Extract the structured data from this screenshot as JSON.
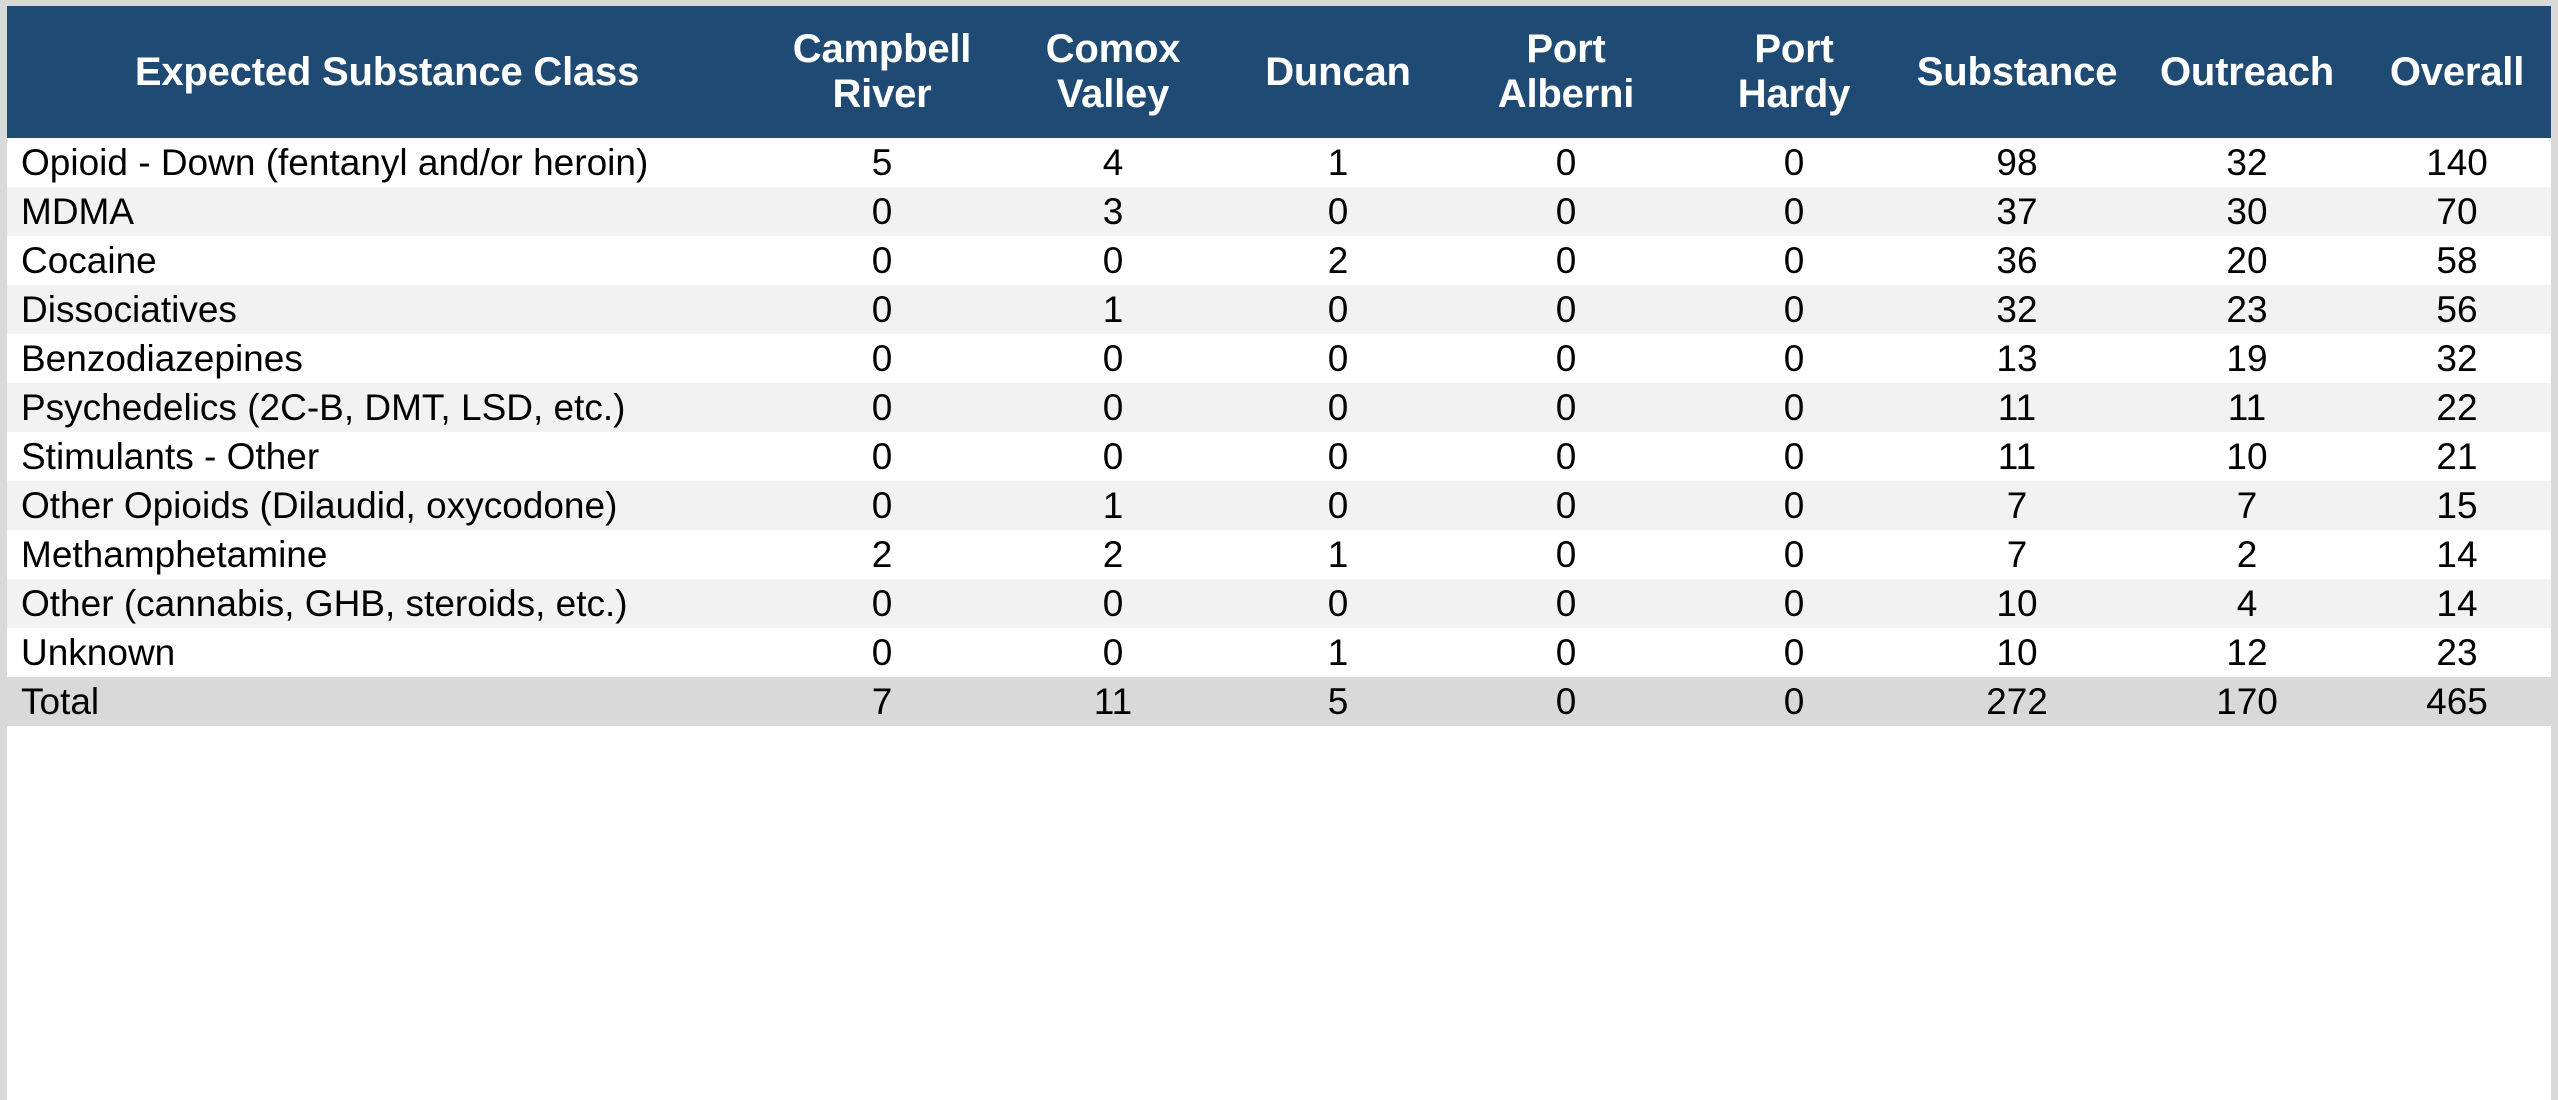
{
  "table": {
    "columns": [
      {
        "key": "label",
        "label": "Expected Substance Class",
        "align": "left"
      },
      {
        "key": "campbell",
        "label": "Campbell River",
        "align": "center"
      },
      {
        "key": "comox",
        "label": "Comox Valley",
        "align": "center"
      },
      {
        "key": "duncan",
        "label": "Duncan",
        "align": "center"
      },
      {
        "key": "alberni",
        "label": "Port Alberni",
        "align": "center"
      },
      {
        "key": "hardy",
        "label": "Port Hardy",
        "align": "center"
      },
      {
        "key": "substance",
        "label": "Substance",
        "align": "center"
      },
      {
        "key": "outreach",
        "label": "Outreach",
        "align": "center"
      },
      {
        "key": "overall",
        "label": "Overall",
        "align": "center"
      }
    ],
    "header": {
      "col_0": "Expected Substance Class",
      "col_1": "Campbell River",
      "col_2": "Comox Valley",
      "col_3": "Duncan",
      "col_4": "Port Alberni",
      "col_5": "Port Hardy",
      "col_6": "Substance",
      "col_7": "Outreach",
      "col_8": "Overall"
    },
    "rows": [
      {
        "label": "Opioid - Down (fentanyl and/or heroin)",
        "campbell": "5",
        "comox": "4",
        "duncan": "1",
        "alberni": "0",
        "hardy": "0",
        "substance": "98",
        "outreach": "32",
        "overall": "140"
      },
      {
        "label": "MDMA",
        "campbell": "0",
        "comox": "3",
        "duncan": "0",
        "alberni": "0",
        "hardy": "0",
        "substance": "37",
        "outreach": "30",
        "overall": "70"
      },
      {
        "label": "Cocaine",
        "campbell": "0",
        "comox": "0",
        "duncan": "2",
        "alberni": "0",
        "hardy": "0",
        "substance": "36",
        "outreach": "20",
        "overall": "58"
      },
      {
        "label": "Dissociatives",
        "campbell": "0",
        "comox": "1",
        "duncan": "0",
        "alberni": "0",
        "hardy": "0",
        "substance": "32",
        "outreach": "23",
        "overall": "56"
      },
      {
        "label": "Benzodiazepines",
        "campbell": "0",
        "comox": "0",
        "duncan": "0",
        "alberni": "0",
        "hardy": "0",
        "substance": "13",
        "outreach": "19",
        "overall": "32"
      },
      {
        "label": "Psychedelics (2C-B, DMT, LSD, etc.)",
        "campbell": "0",
        "comox": "0",
        "duncan": "0",
        "alberni": "0",
        "hardy": "0",
        "substance": "11",
        "outreach": "11",
        "overall": "22"
      },
      {
        "label": "Stimulants - Other",
        "campbell": "0",
        "comox": "0",
        "duncan": "0",
        "alberni": "0",
        "hardy": "0",
        "substance": "11",
        "outreach": "10",
        "overall": "21"
      },
      {
        "label": "Other Opioids (Dilaudid, oxycodone)",
        "campbell": "0",
        "comox": "1",
        "duncan": "0",
        "alberni": "0",
        "hardy": "0",
        "substance": "7",
        "outreach": "7",
        "overall": "15"
      },
      {
        "label": "Methamphetamine",
        "campbell": "2",
        "comox": "2",
        "duncan": "1",
        "alberni": "0",
        "hardy": "0",
        "substance": "7",
        "outreach": "2",
        "overall": "14"
      },
      {
        "label": "Other (cannabis, GHB, steroids, etc.)",
        "campbell": "0",
        "comox": "0",
        "duncan": "0",
        "alberni": "0",
        "hardy": "0",
        "substance": "10",
        "outreach": "4",
        "overall": "14"
      },
      {
        "label": "Unknown",
        "campbell": "0",
        "comox": "0",
        "duncan": "1",
        "alberni": "0",
        "hardy": "0",
        "substance": "10",
        "outreach": "12",
        "overall": "23"
      }
    ],
    "total_row": {
      "label": "Total",
      "campbell": "7",
      "comox": "11",
      "duncan": "5",
      "alberni": "0",
      "hardy": "0",
      "substance": "272",
      "outreach": "170",
      "overall": "465"
    }
  },
  "colors": {
    "header_background": "#1F4A73",
    "header_text": "#FFFFFF",
    "row_odd": "#FFFFFF",
    "row_even": "#F2F2F2",
    "total_row": "#D9D9D9",
    "frame": "#D9D9D9",
    "body_text": "#000000"
  },
  "chart_data": {
    "type": "table",
    "title": "Expected Substance Class",
    "categories": [
      "Opioid - Down (fentanyl and/or heroin)",
      "MDMA",
      "Cocaine",
      "Dissociatives",
      "Benzodiazepines",
      "Psychedelics (2C-B, DMT, LSD, etc.)",
      "Stimulants - Other",
      "Other Opioids (Dilaudid, oxycodone)",
      "Methamphetamine",
      "Other (cannabis, GHB, steroids, etc.)",
      "Unknown",
      "Total"
    ],
    "series": [
      {
        "name": "Campbell River",
        "values": [
          5,
          0,
          0,
          0,
          0,
          0,
          0,
          0,
          2,
          0,
          0,
          7
        ]
      },
      {
        "name": "Comox Valley",
        "values": [
          4,
          3,
          0,
          1,
          0,
          0,
          0,
          1,
          2,
          0,
          0,
          11
        ]
      },
      {
        "name": "Duncan",
        "values": [
          1,
          0,
          2,
          0,
          0,
          0,
          0,
          0,
          1,
          0,
          1,
          5
        ]
      },
      {
        "name": "Port Alberni",
        "values": [
          0,
          0,
          0,
          0,
          0,
          0,
          0,
          0,
          0,
          0,
          0,
          0
        ]
      },
      {
        "name": "Port Hardy",
        "values": [
          0,
          0,
          0,
          0,
          0,
          0,
          0,
          0,
          0,
          0,
          0,
          0
        ]
      },
      {
        "name": "Substance",
        "values": [
          98,
          37,
          36,
          32,
          13,
          11,
          11,
          7,
          7,
          10,
          10,
          272
        ]
      },
      {
        "name": "Outreach",
        "values": [
          32,
          30,
          20,
          23,
          19,
          11,
          10,
          7,
          2,
          4,
          12,
          170
        ]
      },
      {
        "name": "Overall",
        "values": [
          140,
          70,
          58,
          56,
          32,
          22,
          21,
          15,
          14,
          14,
          23,
          465
        ]
      }
    ],
    "xlabel": "",
    "ylabel": "",
    "grid": false,
    "legend": "none"
  }
}
